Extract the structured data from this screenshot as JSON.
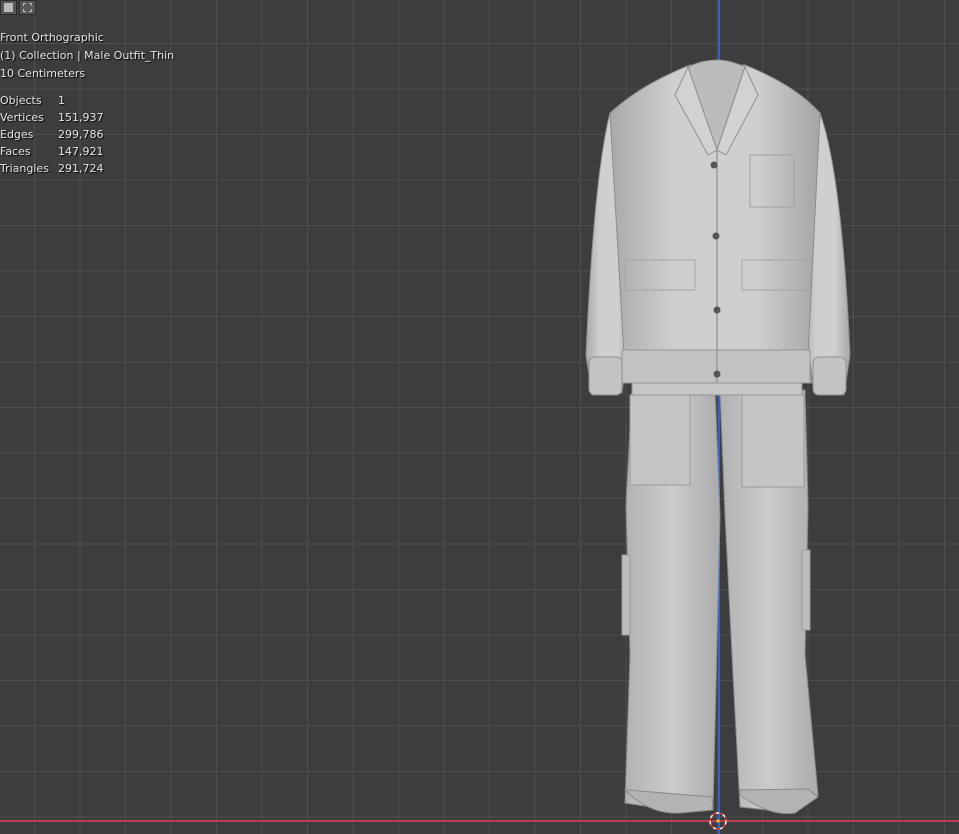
{
  "header": {
    "buttons": [
      "select-box-icon",
      "select-mode-icon"
    ]
  },
  "viewport": {
    "view_name": "Front Orthographic",
    "collection": "(1) Collection | Male Outfit_Thin",
    "scale": "10 Centimeters",
    "stats": [
      {
        "label": "Objects",
        "value": "1"
      },
      {
        "label": "Vertices",
        "value": "151,937"
      },
      {
        "label": "Edges",
        "value": "299,786"
      },
      {
        "label": "Faces",
        "value": "147,921"
      },
      {
        "label": "Triangles",
        "value": "291,724"
      }
    ],
    "colors": {
      "background": "#3d3d3d",
      "z_axis": "#3b5fc9",
      "x_axis": "#b8404c",
      "mesh": "#c8c8c8"
    }
  }
}
